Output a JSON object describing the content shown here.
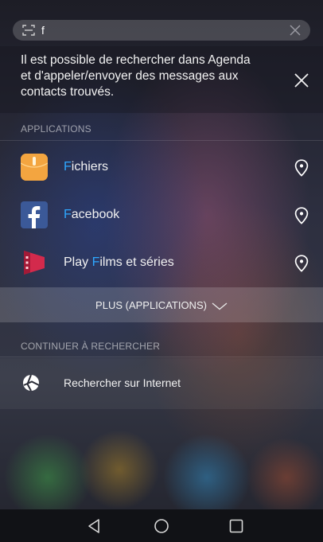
{
  "search": {
    "query": "f"
  },
  "hint": {
    "lines": [
      "Il est possible de rechercher dans Agenda",
      "et d'appeler/envoyer des messages aux",
      "contacts trouvés."
    ]
  },
  "applications_section": {
    "header": "APPLICATIONS",
    "items": [
      {
        "highlight": "F",
        "rest": "ichiers",
        "icon": "files-app-icon",
        "color": "#f0a040"
      },
      {
        "highlight": "F",
        "rest": "acebook",
        "icon": "facebook-app-icon",
        "color": "#3b5998"
      },
      {
        "prefix": "Play ",
        "highlight": "F",
        "rest": "ilms et séries",
        "icon": "play-movies-app-icon",
        "color": "#d0284a"
      }
    ],
    "more_label": "PLUS (APPLICATIONS)"
  },
  "continue_section": {
    "header": "CONTINUER À RECHERCHER",
    "web_label": "Rechercher sur Internet"
  },
  "colors": {
    "highlight": "#2ea7ff"
  }
}
